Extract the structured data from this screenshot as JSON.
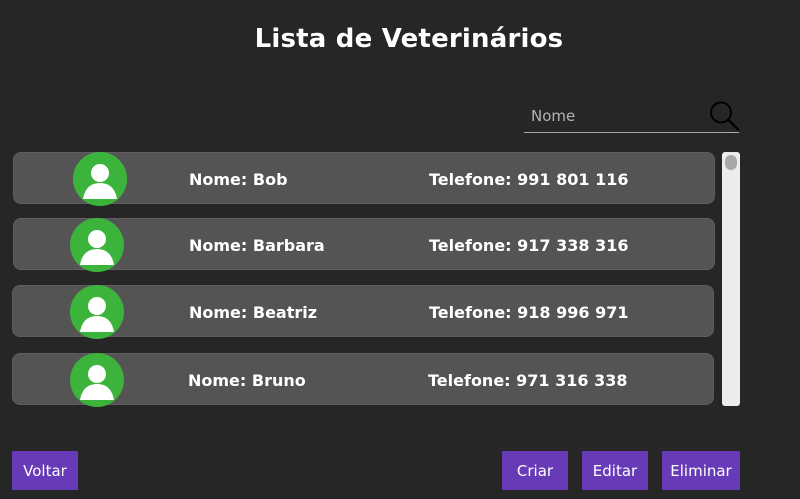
{
  "page": {
    "title": "Lista de Veterinários"
  },
  "search": {
    "placeholder": "Nome"
  },
  "rows": [
    {
      "nome": "Nome: Bob",
      "telefone": "Telefone: 991 801 116"
    },
    {
      "nome": "Nome: Barbara",
      "telefone": "Telefone: 917 338 316"
    },
    {
      "nome": "Nome: Beatriz",
      "telefone": "Telefone: 918 996 971"
    },
    {
      "nome": "Nome: Bruno",
      "telefone": "Telefone: 971 316 338"
    }
  ],
  "buttons": {
    "voltar": "Voltar",
    "criar": "Criar",
    "editar": "Editar",
    "eliminar": "Eliminar"
  },
  "colors": {
    "background": "#262626",
    "row": "#545454",
    "avatar": "#3cb43c",
    "button": "#673ab7"
  },
  "icons": {
    "search": "magnifier-icon",
    "avatar": "user-avatar-icon"
  }
}
